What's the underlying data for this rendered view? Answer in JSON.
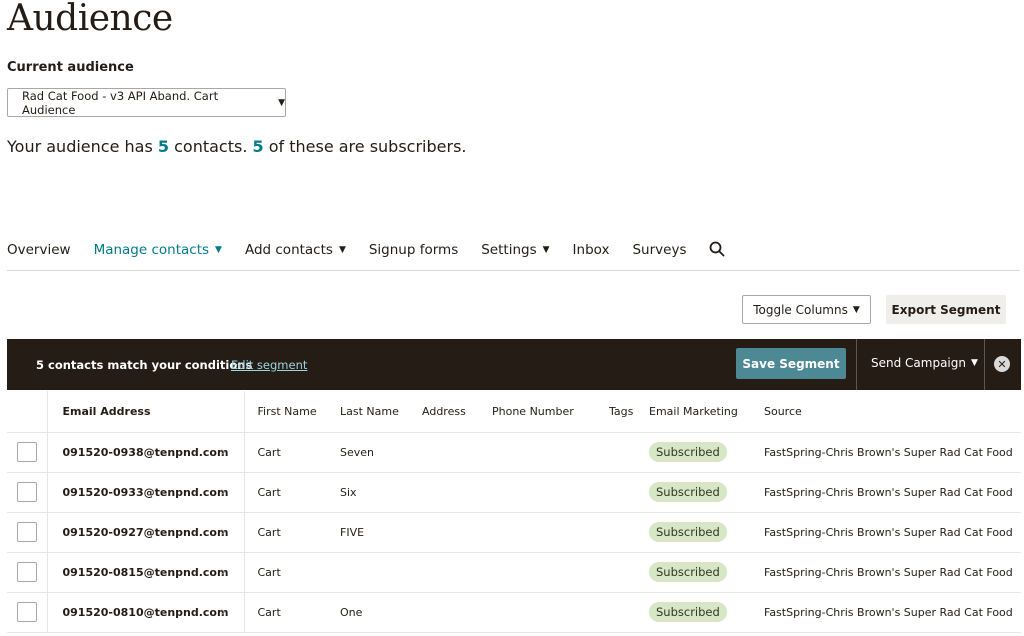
{
  "page": {
    "title": "Audience"
  },
  "audience": {
    "label": "Current audience",
    "selected": "Rad Cat Food - v3 API Aband. Cart Audience",
    "summary_prefix": "Your audience has ",
    "contacts": "5",
    "summary_mid": " contacts. ",
    "subscribers": "5",
    "summary_suffix": " of these are subscribers."
  },
  "tabs": [
    {
      "label": "Overview"
    },
    {
      "label": "Manage contacts"
    },
    {
      "label": "Add contacts"
    },
    {
      "label": "Signup forms"
    },
    {
      "label": "Settings"
    },
    {
      "label": "Inbox"
    },
    {
      "label": "Surveys"
    }
  ],
  "toolbar": {
    "toggle_columns": "Toggle Columns",
    "export_segment": "Export Segment"
  },
  "segment": {
    "match_text": "5 contacts match your conditions",
    "edit_link": "Edit segment",
    "save": "Save Segment",
    "send_campaign": "Send Campaign"
  },
  "table": {
    "headers": [
      "Email Address",
      "First Name",
      "Last Name",
      "Address",
      "Phone Number",
      "Tags",
      "Email Marketing",
      "Source"
    ],
    "rows": [
      {
        "email": "091520-0938@tenpnd.com",
        "first": "Cart",
        "last": "Seven",
        "address": "",
        "phone": "",
        "tags": "",
        "marketing": "Subscribed",
        "source": "FastSpring-Chris Brown's Super Rad Cat Food"
      },
      {
        "email": "091520-0933@tenpnd.com",
        "first": "Cart",
        "last": "Six",
        "address": "",
        "phone": "",
        "tags": "",
        "marketing": "Subscribed",
        "source": "FastSpring-Chris Brown's Super Rad Cat Food"
      },
      {
        "email": "091520-0927@tenpnd.com",
        "first": "Cart",
        "last": "FIVE",
        "address": "",
        "phone": "",
        "tags": "",
        "marketing": "Subscribed",
        "source": "FastSpring-Chris Brown's Super Rad Cat Food"
      },
      {
        "email": "091520-0815@tenpnd.com",
        "first": "Cart",
        "last": "",
        "address": "",
        "phone": "",
        "tags": "",
        "marketing": "Subscribed",
        "source": "FastSpring-Chris Brown's Super Rad Cat Food"
      },
      {
        "email": "091520-0810@tenpnd.com",
        "first": "Cart",
        "last": "One",
        "address": "",
        "phone": "",
        "tags": "",
        "marketing": "Subscribed",
        "source": "FastSpring-Chris Brown's Super Rad Cat Food"
      }
    ]
  },
  "icons": {
    "search": "search-icon",
    "close": "close-icon",
    "chevron": "chevron-down-icon",
    "row_chevron": "chevron-right-icon"
  },
  "colors": {
    "accent": "#007c89",
    "segment_bar": "#241c15",
    "save_button": "#4d8895",
    "badge_bg": "#d7e6c6"
  }
}
